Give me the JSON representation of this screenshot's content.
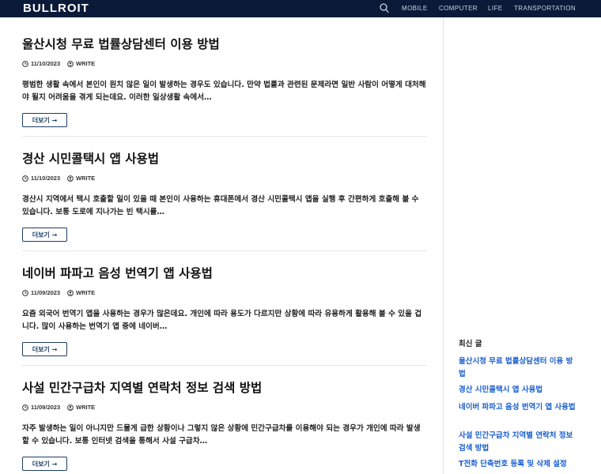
{
  "header": {
    "logo": "BULLROIT",
    "nav": [
      "MOBILE",
      "COMPUTER",
      "LIFE",
      "TRANSPORTATION"
    ],
    "search_icon": "search-icon"
  },
  "posts": [
    {
      "title": "울산시청 무료 법률상담센터 이용 방법",
      "date": "11/10/2023",
      "author": "WRITE",
      "excerpt": "평범한 생활 속에서 본인이 원치 않은 일이 발생하는 경우도 있습니다. 만약 법률과 관련된 문제라면 일반 사람이 어떻게 대처해야 될지 어려움을 겪게 되는데요. 이러한 일상생활 속에서…",
      "more": "더보기 →"
    },
    {
      "title": "경산 시민콜택시 앱 사용법",
      "date": "11/10/2023",
      "author": "WRITE",
      "excerpt": "경산시 지역에서 택시 호출할 일이 있을 때 본인이 사용하는 휴대폰에서 경산 시민콜택시 앱을 실행 후 간편하게 호출해 볼 수 있습니다. 보통 도로에 지나가는 빈 택시를…",
      "more": "더보기 →"
    },
    {
      "title": "네이버 파파고 음성 번역기 앱 사용법",
      "date": "11/09/2023",
      "author": "WRITE",
      "excerpt": "요즘 외국어 번역기 앱을 사용하는 경우가 많은데요. 개인에 따라 용도가 다르지만 상황에 따라 유용하게 활용해 볼 수 있을 겁니다. 많이 사용하는 번역기 앱 중에 네이버…",
      "more": "더보기 →"
    },
    {
      "title": "사설 민간구급차 지역별 연락처 정보 검색 방법",
      "date": "11/09/2023",
      "author": "WRITE",
      "excerpt": "자주 발생하는 일이 아니지만 드물게 급한 상황이나 그렇지 않은 상황에 민간구급차를 이용해야 되는 경우가 개인에 따라 발생할 수 있습니다. 보통 인터넷 검색을 통해서 사설 구급차…",
      "more": "더보기 →"
    }
  ],
  "sidebar": {
    "recent_title": "최신 글",
    "recent": [
      "울산시청 무료 법률상담센터 이용 방법",
      "경산 시민콜택시 앱 사용법",
      "네이버 파파고 음성 번역기 앱 사용법",
      "사설 민간구급차 지역별 연락처 정보 검색 방법",
      "T전화 단축번호 등록 및 삭제 설정"
    ]
  },
  "colors": {
    "header_bg": "#0a1a38",
    "link": "#1a5fd0",
    "button_border": "#1c3d66"
  }
}
